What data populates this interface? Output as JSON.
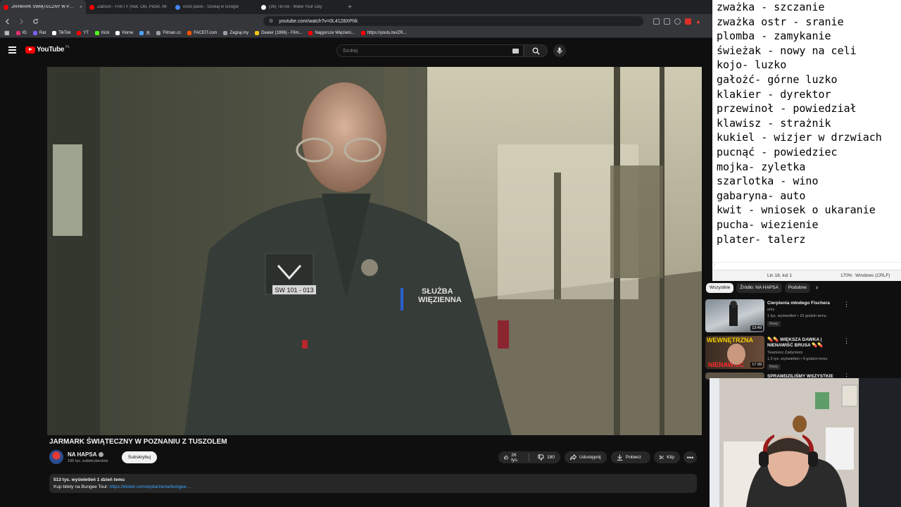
{
  "browser": {
    "tabs": [
      {
        "title": "JARMARK ŚWIĄTECZNY W POZNANIU",
        "color": "#ff0000",
        "active": true
      },
      {
        "title": "Zabson - FAKTY (feat. Oki, Pezet, Mł",
        "color": "#ff0000",
        "active": false
      },
      {
        "title": "crest paski - Szukaj w Google",
        "color": "#4285f4",
        "active": false
      },
      {
        "title": "(36) TikTok - Make Your Day",
        "color": "#ffffff",
        "active": false
      }
    ],
    "new_tab": "+",
    "url": "youtube.com/watch?v=0L4128XPIIk",
    "bookmarks": [
      {
        "label": "IG",
        "color": "#e1306c"
      },
      {
        "label": "Rat",
        "color": "#7b61ff"
      },
      {
        "label": "TikTok",
        "color": "#ffffff"
      },
      {
        "label": "YT",
        "color": "#ff0000"
      },
      {
        "label": "Kick",
        "color": "#53fc18"
      },
      {
        "label": "Home",
        "color": "#ffffff"
      },
      {
        "label": "天",
        "color": "#4da3ff"
      },
      {
        "label": "Filman.cc",
        "color": "#9aa0a6"
      },
      {
        "label": "FACEIT.com",
        "color": "#ff5500"
      },
      {
        "label": "Zagraj.my",
        "color": "#9aa0a6"
      },
      {
        "label": "Dealer (1996) - Film...",
        "color": "#f5c518"
      },
      {
        "label": "Najgorsze Więzieni...",
        "color": "#ff0000"
      },
      {
        "label": "https://youtu.be/ZR...",
        "color": "#ff0000"
      }
    ]
  },
  "youtube": {
    "logo": "YouTube",
    "country": "PL",
    "search_placeholder": "Szukaj",
    "video": {
      "title": "JARMARK ŚWIĄTECZNY W POZNANIU Z TUSZOLEM",
      "channel": "NA HAPSA",
      "subscribers": "196 tys. subskrybentów",
      "subscribe_label": "Subskrybuj",
      "likes": "26 tys.",
      "dislikes": "180",
      "share_label": "Udostępnij",
      "download_label": "Pobierz",
      "clip_label": "Klip",
      "views_meta": "513 tys. wyświetleń  1 dzień temu",
      "desc_prefix": "Kup bilety na Bungee Tour: ",
      "desc_link": "https://kicket.com/wydarzenia/bungee-...",
      "patch_text": "SW 101 - 013",
      "badge_text_1": "SŁUŻBA",
      "badge_text_2": "WIĘZIENNA"
    },
    "chips": [
      "Wszystkie",
      "Źródło: NA HAPSA",
      "Podobne"
    ],
    "related": [
      {
        "title": "Cierpienia młodego Fischera",
        "channel": "erkz",
        "meta": "1 tys. wyświetleń • 10 godzin temu",
        "badge": "Nowy",
        "duration": "13:49"
      },
      {
        "title": "💊💊 WIĘKSZA DAWKA | NIENAWIŚĆ BRUSA 💊💊",
        "channel": "Tewmiorz Zadymiorz",
        "meta": "1,5 tys. wyświetleń • 9 godzin temu",
        "badge": "Nowy",
        "duration": "17:39",
        "thumb_top": "WEWNĘTRZNA",
        "thumb_bottom": "NIENAWIŚĆ"
      },
      {
        "title": "SPRAWDZILIŚMY WSZYSTKIE",
        "channel": "",
        "meta": "",
        "badge": "",
        "duration": ""
      }
    ]
  },
  "notepad": {
    "lines": [
      "zważka - szczanie",
      "zważka ostr - sranie",
      "plomba - zamykanie",
      "świeżak - nowy na celi",
      "kojo- luzko",
      "gałożć- górne luzko",
      "klakier - dyrektor",
      "przewinoł - powiedział",
      "klawisz - strażnik",
      "kukiel - wizjer w drzwiach",
      "pucnąć - powiedziec",
      "mojka- zyletka",
      "szarlotka - wino",
      "gabaryna- auto",
      "kwit - wniosek o ukaranie",
      "pucha- wiezienie",
      "plater- talerz"
    ],
    "status_pos": "Lin 18, kol 1",
    "status_zoom": "170%",
    "status_eol": "Windows (CRLF)"
  },
  "colors": {
    "yt_bg": "#0f0f0f",
    "yt_red": "#ff0000",
    "link": "#3ea6ff",
    "pill_bg": "#272727"
  }
}
